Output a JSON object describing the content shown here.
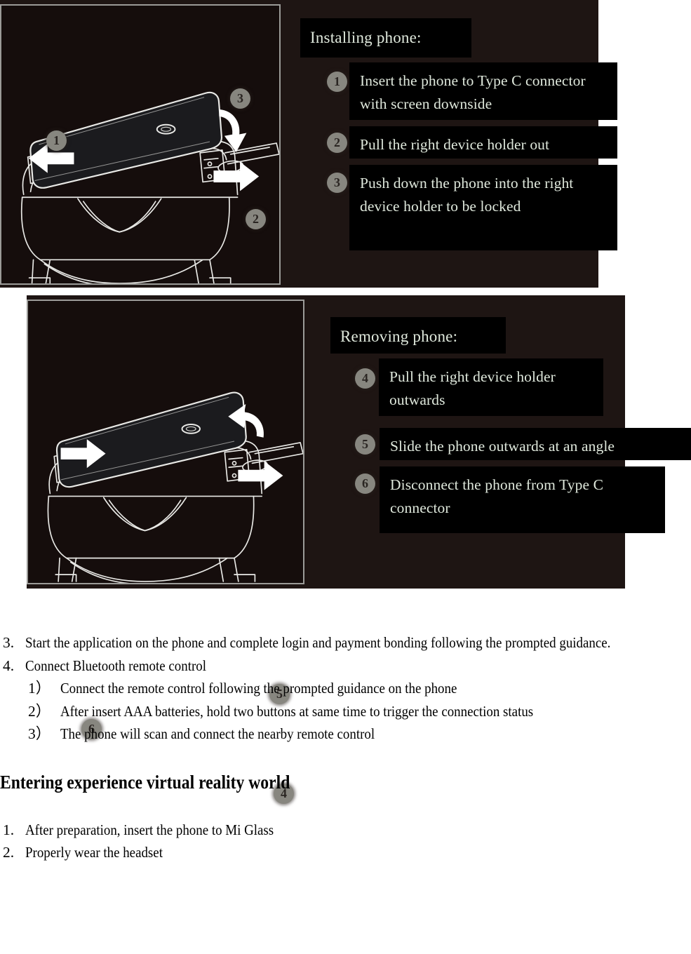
{
  "page": {
    "background": "#ffffff",
    "panel_backdrop_color": "#1e1513",
    "callout_bg": "#000000",
    "callout_text_color": "#dfe8dc",
    "badge_color": "#87867f",
    "frame_border_color": "#9b9b98"
  },
  "install_section": {
    "title": "Installing phone:",
    "illustration": {
      "name": "vr-headset-install-diagram",
      "badges": [
        "1",
        "2",
        "3"
      ],
      "description": "VR headset with phone inserted, white line art on dark background"
    },
    "steps": [
      {
        "num": "1",
        "text": "Insert the phone to Type C connector with screen downside"
      },
      {
        "num": "2",
        "text": "Pull the right device holder out"
      },
      {
        "num": "3",
        "text": "Push down the phone into the right device holder to be locked"
      }
    ]
  },
  "remove_section": {
    "title": "Removing phone:",
    "illustration": {
      "name": "vr-headset-remove-diagram",
      "badges": [
        "4",
        "5",
        "6"
      ],
      "description": "VR headset with phone being removed, white line art on dark background"
    },
    "steps": [
      {
        "num": "4",
        "text": "Pull the right device holder outwards"
      },
      {
        "num": "5",
        "text": "Slide the phone outwards at an angle"
      },
      {
        "num": "6",
        "text": "Disconnect the phone from Type C connector"
      }
    ]
  },
  "document": {
    "preparation_items": [
      {
        "num": "3.",
        "text": "Start the application on the phone and complete login and payment bonding following the prompted guidance.",
        "level": 1
      },
      {
        "num": "4.",
        "text": "Connect Bluetooth remote control",
        "level": 1
      },
      {
        "num": "1）",
        "text": "Connect the remote control following the prompted guidance on the phone",
        "level": 2
      },
      {
        "num": "2）",
        "text": "After insert AAA batteries, hold two buttons at same time to trigger the connection status",
        "level": 2
      },
      {
        "num": "3）",
        "text": "The phone will scan and connect the nearby remote control",
        "level": 2
      }
    ],
    "heading": "Entering experience virtual reality world",
    "experience_items": [
      {
        "num": "1.",
        "text": "After preparation, insert the phone to Mi Glass",
        "level": 1
      },
      {
        "num": "2.",
        "text": "Properly wear the headset",
        "level": 1
      }
    ]
  }
}
